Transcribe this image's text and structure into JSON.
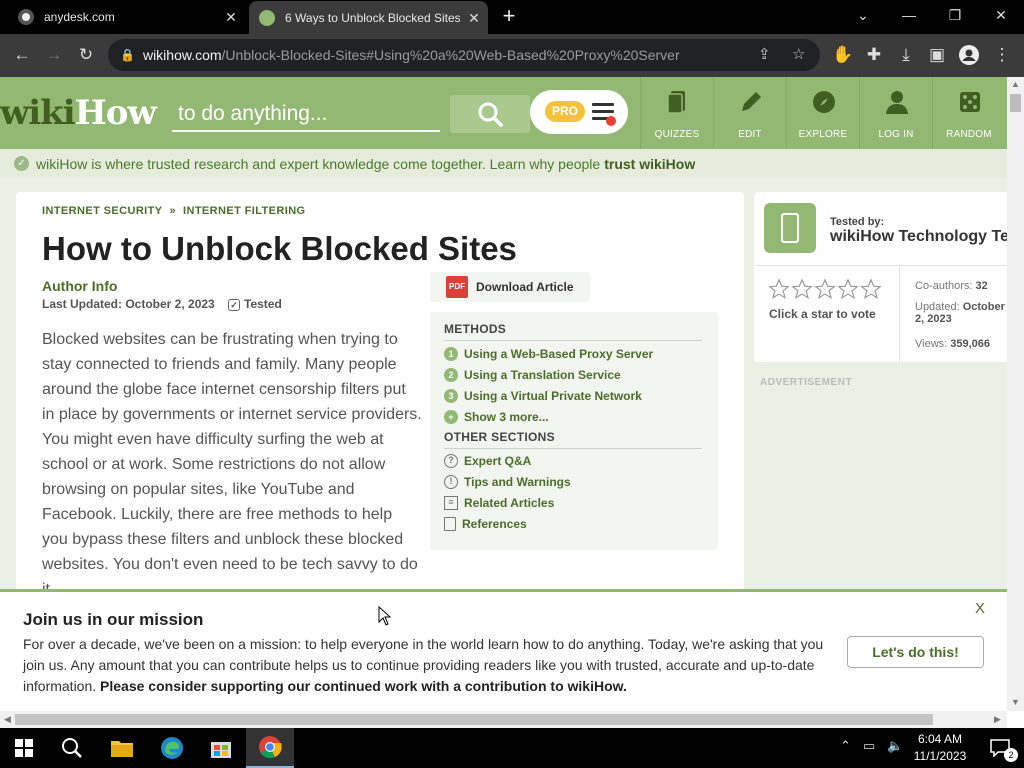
{
  "browser": {
    "tabs": [
      {
        "title": "anydesk.com",
        "active": false
      },
      {
        "title": "6 Ways to Unblock Blocked Sites",
        "active": true
      }
    ],
    "url_host": "wikihow.com",
    "url_path": "/Unblock-Blocked-Sites#Using%20a%20Web-Based%20Proxy%20Server"
  },
  "header": {
    "logo_part1": "wiki",
    "logo_part2": "How",
    "search_placeholder": "to do anything...",
    "pro_badge": "PRO",
    "nav": [
      {
        "label": "QUIZZES",
        "icon": "quiz-icon"
      },
      {
        "label": "EDIT",
        "icon": "pencil-icon"
      },
      {
        "label": "EXPLORE",
        "icon": "compass-icon"
      },
      {
        "label": "LOG IN",
        "icon": "user-icon"
      },
      {
        "label": "RANDOM",
        "icon": "dice-icon"
      }
    ]
  },
  "trust_bar": {
    "text": "wikiHow is where trusted research and expert knowledge come together. Learn why people",
    "link": "trust wikiHow"
  },
  "article": {
    "breadcrumb": [
      "INTERNET SECURITY",
      "INTERNET FILTERING"
    ],
    "breadcrumb_sep": "»",
    "title": "How to Unblock Blocked Sites",
    "author": "Author Info",
    "updated": "Last Updated: October 2, 2023",
    "tested": "Tested",
    "intro": "Blocked websites can be frustrating when trying to stay connected to friends and family. Many people around the globe face internet censorship filters put in place by governments or internet service providers. You might even have difficulty surfing the web at school or at work. Some restrictions do not allow browsing on popular sites, like YouTube and Facebook. Luckily, there are free methods to help you bypass these filters and unblock these blocked websites. You don't even need to be tech savvy to do it.",
    "download_label": "Download Article",
    "pdf_label": "PDF"
  },
  "toc": {
    "methods_heading": "METHODS",
    "methods": [
      {
        "num": "1",
        "label": "Using a Web-Based Proxy Server"
      },
      {
        "num": "2",
        "label": "Using a Translation Service"
      },
      {
        "num": "3",
        "label": "Using a Virtual Private Network"
      }
    ],
    "show_more": "Show 3 more...",
    "other_heading": "OTHER SECTIONS",
    "other": [
      {
        "label": "Expert Q&A",
        "icon_char": "?"
      },
      {
        "label": "Tips and Warnings",
        "icon_char": "!"
      },
      {
        "label": "Related Articles",
        "icon_char": "≡"
      },
      {
        "label": "References",
        "icon_char": ""
      }
    ]
  },
  "sidebar": {
    "tested_by_label": "Tested by:",
    "tested_by_name": "wikiHow Technology Team",
    "vote_text": "Click a star to vote",
    "coauthors_label": "Co-authors:",
    "coauthors_value": "32",
    "updated_label": "Updated:",
    "updated_value": "October 2, 2023",
    "views_label": "Views:",
    "views_value": "359,066",
    "advertisement": "ADVERTISEMENT"
  },
  "banner": {
    "title": "Join us in our mission",
    "body": "For over a decade, we've been on a mission: to help everyone in the world learn how to do anything. Today, we're asking that you join us. Any amount that you can contribute helps us to continue providing readers like you with trusted, accurate and up-to-date information.",
    "body_bold": "Please consider supporting our continued work with a contribution to wikiHow.",
    "cta": "Let's do this!",
    "close": "X"
  },
  "taskbar": {
    "time": "6:04 AM",
    "date": "11/1/2023",
    "notification_count": "2"
  },
  "colors": {
    "brand_green": "#93b874",
    "dark_green": "#4a6e2a",
    "pro_yellow": "#f2c23a"
  }
}
